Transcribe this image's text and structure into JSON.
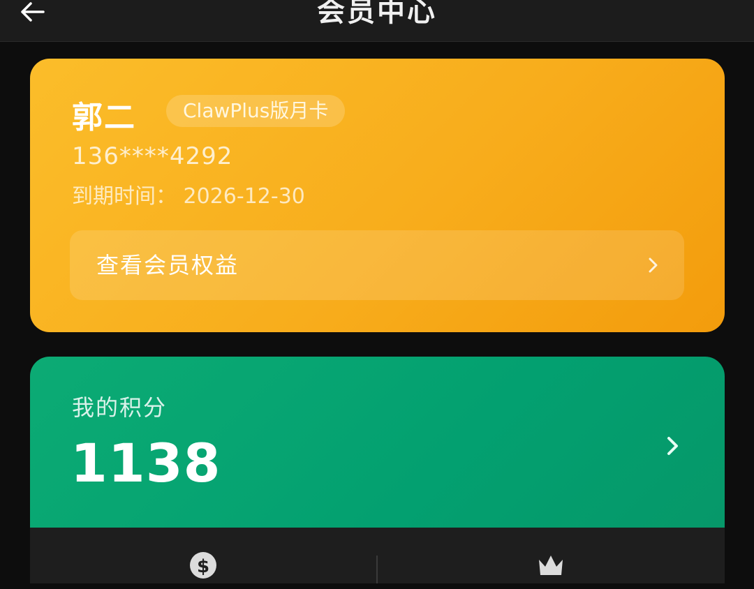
{
  "header": {
    "title": "会员中心",
    "back_icon": "arrow-left-icon"
  },
  "member_card": {
    "name": "郭二",
    "badge": "ClawPlus版月卡",
    "phone": "136****4292",
    "expire_text": "到期时间：  2026-12-30",
    "benefits_label": "查看会员权益",
    "colors": {
      "gradient_start": "#fbbd2a",
      "gradient_end": "#f39c0c"
    }
  },
  "points_card": {
    "label": "我的积分",
    "value": "1138",
    "colors": {
      "gradient_start": "#0cab74",
      "gradient_end": "#069869"
    }
  },
  "actions": [
    {
      "icon": "dollar-coin-icon"
    },
    {
      "icon": "crown-icon"
    }
  ]
}
